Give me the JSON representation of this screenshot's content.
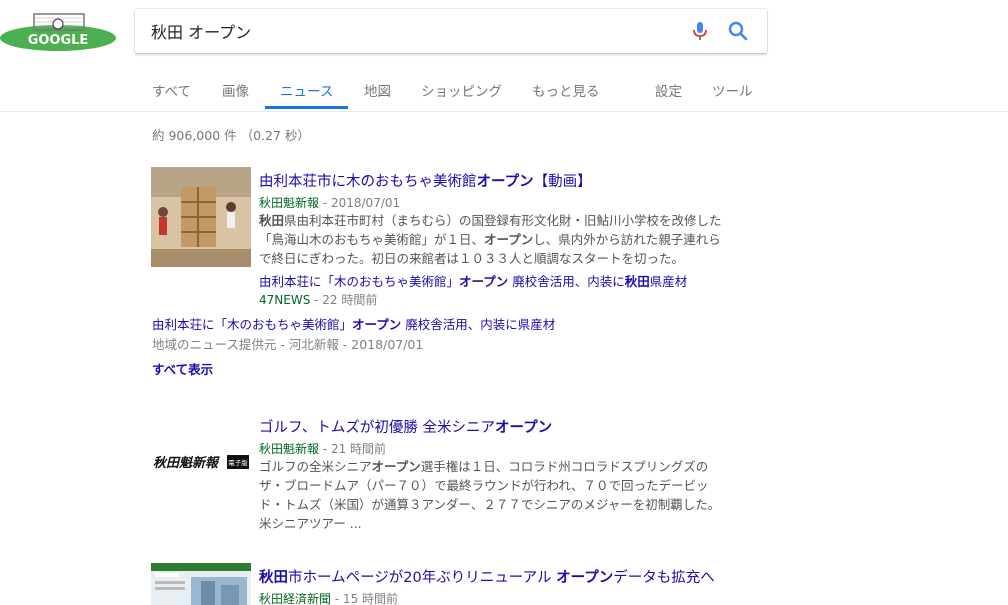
{
  "search": {
    "query": "秋田 オープン"
  },
  "logo": {
    "text": "GOOGLE"
  },
  "tabs": [
    {
      "label": "すべて"
    },
    {
      "label": "画像"
    },
    {
      "label": "ニュース"
    },
    {
      "label": "地図"
    },
    {
      "label": "ショッピング"
    },
    {
      "label": "もっと見る"
    },
    {
      "label": "設定"
    },
    {
      "label": "ツール"
    }
  ],
  "result_stats": "約 906,000 件 （0.27 秒）",
  "results": [
    {
      "title_parts": [
        "由利本荘市に木のおもちゃ美術館",
        "オープン",
        "【動画】"
      ],
      "source": "秋田魁新報",
      "time": " - 2018/07/01",
      "snippet_lines": [
        [
          "秋田",
          "県由利本荘市町村（まちむら）の国登録有形文化財・旧鮎川小学校を改修した"
        ],
        [
          "「鳥海山木のおもちゃ美術館」が１日、",
          "オープン",
          "し、県内外から訪れた親子連れら"
        ],
        [
          "で終日にぎわった。初日の来館者は１０３３人と順調なスタートを切った。"
        ]
      ],
      "related_title": [
        "由利本荘に「木のおもちゃ美術館」",
        "オープン",
        " 廃校舎活用、内装に",
        "秋田",
        "県産材"
      ],
      "related_source": "47NEWS",
      "related_time": " - 22 時間前",
      "extra_title": [
        "由利本荘に「木のおもちゃ美術館」",
        "オープン",
        " 廃校舎活用、内装に県産材"
      ],
      "extra_source": "地域のニュース提供元 - 河北新報 - 2018/07/01",
      "show_all": "すべて表示"
    },
    {
      "title_parts": [
        "ゴルフ、トムズが初優勝 全米シニア",
        "オープン"
      ],
      "logo_text": "秋田魁新報",
      "logo_badge": "電子版",
      "source": "秋田魁新報",
      "time": " - 21 時間前",
      "snippet_lines": [
        [
          "ゴルフの全米シニア",
          "オープン",
          "選手権は１日、コロラド州コロラドスプリングズの"
        ],
        [
          "ザ・ブロードムア（パー７０）で最終ラウンドが行われ、７０で回ったデービッ"
        ],
        [
          "ド・トムズ（米国）が通算３アンダー、２７７でシニアのメジャーを初制覇した。"
        ],
        [
          "米シニアツアー ..."
        ]
      ]
    },
    {
      "title_parts": [
        "秋田",
        "市ホームページが20年ぶりリニューアル ",
        "オープン",
        "データも拡充へ"
      ],
      "source": "秋田経済新聞",
      "time": " - 15 時間前"
    }
  ],
  "colors": {
    "link": "#1a0dab",
    "source_green": "#006621",
    "active_tab": "#1a73e8",
    "mic_blue": "#4285f4",
    "mic_red": "#ea4335"
  }
}
